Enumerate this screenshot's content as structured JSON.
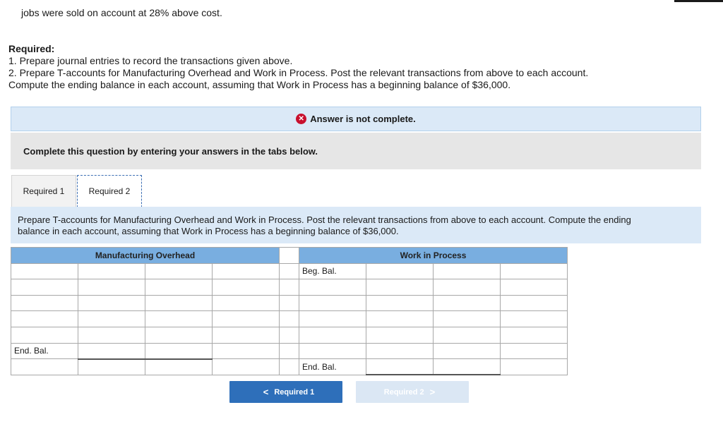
{
  "intro_text": "jobs were sold on account at 28% above cost.",
  "required": {
    "heading": "Required:",
    "line1": "1. Prepare journal entries to record the transactions given above.",
    "line2": "2. Prepare T-accounts for Manufacturing Overhead and Work in Process. Post the relevant transactions from above to each account.",
    "line3": "Compute the ending balance in each account, assuming that Work in Process has a beginning balance of $36,000."
  },
  "answer_banner": {
    "icon": "x-circle-icon",
    "text": "Answer is not complete."
  },
  "instruction": "Complete this question by entering your answers in the tabs below.",
  "tabs": [
    {
      "label": "Required 1",
      "active": false
    },
    {
      "label": "Required 2",
      "active": true
    }
  ],
  "prompt": {
    "line1": "Prepare T-accounts for Manufacturing Overhead and Work in Process. Post the relevant transactions from above to each account. Compute the ending",
    "line2": "balance in each account, assuming that Work in Process has a beginning balance of $36,000."
  },
  "t_accounts": {
    "left_title": "Manufacturing Overhead",
    "right_title": "Work in Process",
    "beg_bal_label": "Beg. Bal.",
    "end_bal_label": "End. Bal."
  },
  "nav": {
    "prev_label": "Required 1",
    "next_label": "Required 2",
    "prev_icon": "chevron-left-icon",
    "next_icon": "chevron-right-icon"
  },
  "colors": {
    "header_blue": "#79aee0",
    "banner_blue": "#dbe9f7",
    "error_red": "#c8102e",
    "button_blue": "#2e6fba",
    "button_disabled": "#dbe7f4"
  }
}
